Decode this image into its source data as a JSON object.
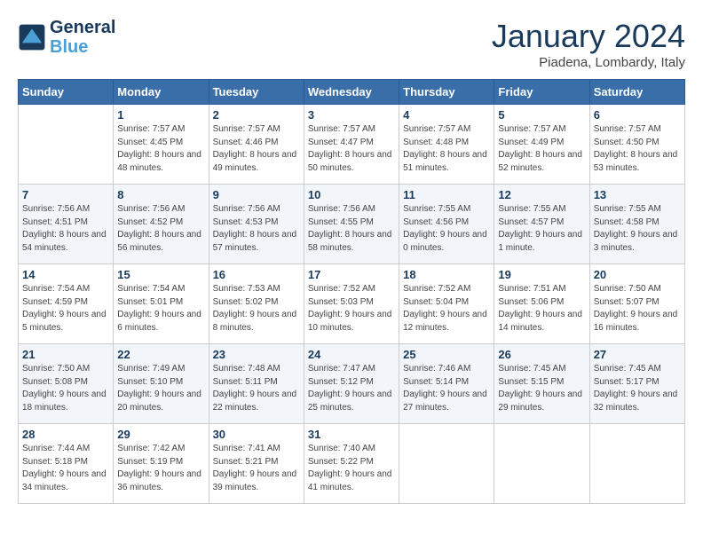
{
  "header": {
    "logo_line1": "General",
    "logo_line2": "Blue",
    "title": "January 2024",
    "location": "Piadena, Lombardy, Italy"
  },
  "columns": [
    "Sunday",
    "Monday",
    "Tuesday",
    "Wednesday",
    "Thursday",
    "Friday",
    "Saturday"
  ],
  "weeks": [
    [
      {
        "day": "",
        "sunrise": "",
        "sunset": "",
        "daylight": ""
      },
      {
        "day": "1",
        "sunrise": "Sunrise: 7:57 AM",
        "sunset": "Sunset: 4:45 PM",
        "daylight": "Daylight: 8 hours and 48 minutes."
      },
      {
        "day": "2",
        "sunrise": "Sunrise: 7:57 AM",
        "sunset": "Sunset: 4:46 PM",
        "daylight": "Daylight: 8 hours and 49 minutes."
      },
      {
        "day": "3",
        "sunrise": "Sunrise: 7:57 AM",
        "sunset": "Sunset: 4:47 PM",
        "daylight": "Daylight: 8 hours and 50 minutes."
      },
      {
        "day": "4",
        "sunrise": "Sunrise: 7:57 AM",
        "sunset": "Sunset: 4:48 PM",
        "daylight": "Daylight: 8 hours and 51 minutes."
      },
      {
        "day": "5",
        "sunrise": "Sunrise: 7:57 AM",
        "sunset": "Sunset: 4:49 PM",
        "daylight": "Daylight: 8 hours and 52 minutes."
      },
      {
        "day": "6",
        "sunrise": "Sunrise: 7:57 AM",
        "sunset": "Sunset: 4:50 PM",
        "daylight": "Daylight: 8 hours and 53 minutes."
      }
    ],
    [
      {
        "day": "7",
        "sunrise": "Sunrise: 7:56 AM",
        "sunset": "Sunset: 4:51 PM",
        "daylight": "Daylight: 8 hours and 54 minutes."
      },
      {
        "day": "8",
        "sunrise": "Sunrise: 7:56 AM",
        "sunset": "Sunset: 4:52 PM",
        "daylight": "Daylight: 8 hours and 56 minutes."
      },
      {
        "day": "9",
        "sunrise": "Sunrise: 7:56 AM",
        "sunset": "Sunset: 4:53 PM",
        "daylight": "Daylight: 8 hours and 57 minutes."
      },
      {
        "day": "10",
        "sunrise": "Sunrise: 7:56 AM",
        "sunset": "Sunset: 4:55 PM",
        "daylight": "Daylight: 8 hours and 58 minutes."
      },
      {
        "day": "11",
        "sunrise": "Sunrise: 7:55 AM",
        "sunset": "Sunset: 4:56 PM",
        "daylight": "Daylight: 9 hours and 0 minutes."
      },
      {
        "day": "12",
        "sunrise": "Sunrise: 7:55 AM",
        "sunset": "Sunset: 4:57 PM",
        "daylight": "Daylight: 9 hours and 1 minute."
      },
      {
        "day": "13",
        "sunrise": "Sunrise: 7:55 AM",
        "sunset": "Sunset: 4:58 PM",
        "daylight": "Daylight: 9 hours and 3 minutes."
      }
    ],
    [
      {
        "day": "14",
        "sunrise": "Sunrise: 7:54 AM",
        "sunset": "Sunset: 4:59 PM",
        "daylight": "Daylight: 9 hours and 5 minutes."
      },
      {
        "day": "15",
        "sunrise": "Sunrise: 7:54 AM",
        "sunset": "Sunset: 5:01 PM",
        "daylight": "Daylight: 9 hours and 6 minutes."
      },
      {
        "day": "16",
        "sunrise": "Sunrise: 7:53 AM",
        "sunset": "Sunset: 5:02 PM",
        "daylight": "Daylight: 9 hours and 8 minutes."
      },
      {
        "day": "17",
        "sunrise": "Sunrise: 7:52 AM",
        "sunset": "Sunset: 5:03 PM",
        "daylight": "Daylight: 9 hours and 10 minutes."
      },
      {
        "day": "18",
        "sunrise": "Sunrise: 7:52 AM",
        "sunset": "Sunset: 5:04 PM",
        "daylight": "Daylight: 9 hours and 12 minutes."
      },
      {
        "day": "19",
        "sunrise": "Sunrise: 7:51 AM",
        "sunset": "Sunset: 5:06 PM",
        "daylight": "Daylight: 9 hours and 14 minutes."
      },
      {
        "day": "20",
        "sunrise": "Sunrise: 7:50 AM",
        "sunset": "Sunset: 5:07 PM",
        "daylight": "Daylight: 9 hours and 16 minutes."
      }
    ],
    [
      {
        "day": "21",
        "sunrise": "Sunrise: 7:50 AM",
        "sunset": "Sunset: 5:08 PM",
        "daylight": "Daylight: 9 hours and 18 minutes."
      },
      {
        "day": "22",
        "sunrise": "Sunrise: 7:49 AM",
        "sunset": "Sunset: 5:10 PM",
        "daylight": "Daylight: 9 hours and 20 minutes."
      },
      {
        "day": "23",
        "sunrise": "Sunrise: 7:48 AM",
        "sunset": "Sunset: 5:11 PM",
        "daylight": "Daylight: 9 hours and 22 minutes."
      },
      {
        "day": "24",
        "sunrise": "Sunrise: 7:47 AM",
        "sunset": "Sunset: 5:12 PM",
        "daylight": "Daylight: 9 hours and 25 minutes."
      },
      {
        "day": "25",
        "sunrise": "Sunrise: 7:46 AM",
        "sunset": "Sunset: 5:14 PM",
        "daylight": "Daylight: 9 hours and 27 minutes."
      },
      {
        "day": "26",
        "sunrise": "Sunrise: 7:45 AM",
        "sunset": "Sunset: 5:15 PM",
        "daylight": "Daylight: 9 hours and 29 minutes."
      },
      {
        "day": "27",
        "sunrise": "Sunrise: 7:45 AM",
        "sunset": "Sunset: 5:17 PM",
        "daylight": "Daylight: 9 hours and 32 minutes."
      }
    ],
    [
      {
        "day": "28",
        "sunrise": "Sunrise: 7:44 AM",
        "sunset": "Sunset: 5:18 PM",
        "daylight": "Daylight: 9 hours and 34 minutes."
      },
      {
        "day": "29",
        "sunrise": "Sunrise: 7:42 AM",
        "sunset": "Sunset: 5:19 PM",
        "daylight": "Daylight: 9 hours and 36 minutes."
      },
      {
        "day": "30",
        "sunrise": "Sunrise: 7:41 AM",
        "sunset": "Sunset: 5:21 PM",
        "daylight": "Daylight: 9 hours and 39 minutes."
      },
      {
        "day": "31",
        "sunrise": "Sunrise: 7:40 AM",
        "sunset": "Sunset: 5:22 PM",
        "daylight": "Daylight: 9 hours and 41 minutes."
      },
      {
        "day": "",
        "sunrise": "",
        "sunset": "",
        "daylight": ""
      },
      {
        "day": "",
        "sunrise": "",
        "sunset": "",
        "daylight": ""
      },
      {
        "day": "",
        "sunrise": "",
        "sunset": "",
        "daylight": ""
      }
    ]
  ]
}
